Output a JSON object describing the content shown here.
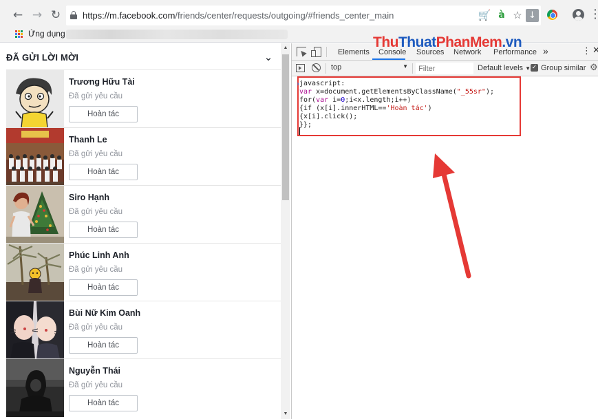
{
  "browser": {
    "url_host": "https://m.facebook.com",
    "url_path": "/friends/center/requests/outgoing/#friends_center_main",
    "bookmarks_apps_label": "Ứng dụng"
  },
  "friend_requests": {
    "header_title": "ĐÃ GỬI LỜI MỜI",
    "items": [
      {
        "name": "Trương Hữu Tài",
        "status": "Đã gửi yêu cầu",
        "button": "Hoàn tác"
      },
      {
        "name": "Thanh Le",
        "status": "Đã gửi yêu cầu",
        "button": "Hoàn tác"
      },
      {
        "name": "Siro Hạnh",
        "status": "Đã gửi yêu cầu",
        "button": "Hoàn tác"
      },
      {
        "name": "Phúc Linh Anh",
        "status": "Đã gửi yêu cầu",
        "button": "Hoàn tác"
      },
      {
        "name": "Bùi Nữ Kim Oanh",
        "status": "Đã gửi yêu cầu",
        "button": "Hoàn tác"
      },
      {
        "name": "Nguyễn Thái",
        "status": "Đã gửi yêu cầu",
        "button": "Hoàn tác"
      }
    ]
  },
  "devtools": {
    "tabs": [
      "Elements",
      "Console",
      "Sources",
      "Network",
      "Performance"
    ],
    "active_tab": "Console",
    "more_tabs": "»",
    "context": "top",
    "filter_placeholder": "Filter",
    "levels": "Default levels",
    "group_similar": "Group similar",
    "group_similar_checked": true,
    "code_lines": [
      "javascript:",
      "var x=document.getElementsByClassName(\"_55sr\");",
      "for(var i=0;i<x.length;i++)",
      "{if (x[i].innerHTML=='Hoàn tác')",
      "{x[i].click();",
      "}};"
    ]
  },
  "watermark": {
    "part1": "Thu",
    "part2": "Thuat",
    "part3": "PhanMem",
    "part4": ".vn"
  },
  "colors": {
    "accent_blue": "#1a73e8",
    "highlight_red": "#e53935",
    "facebook_text": "#1d2129",
    "muted_text": "#90949c"
  }
}
